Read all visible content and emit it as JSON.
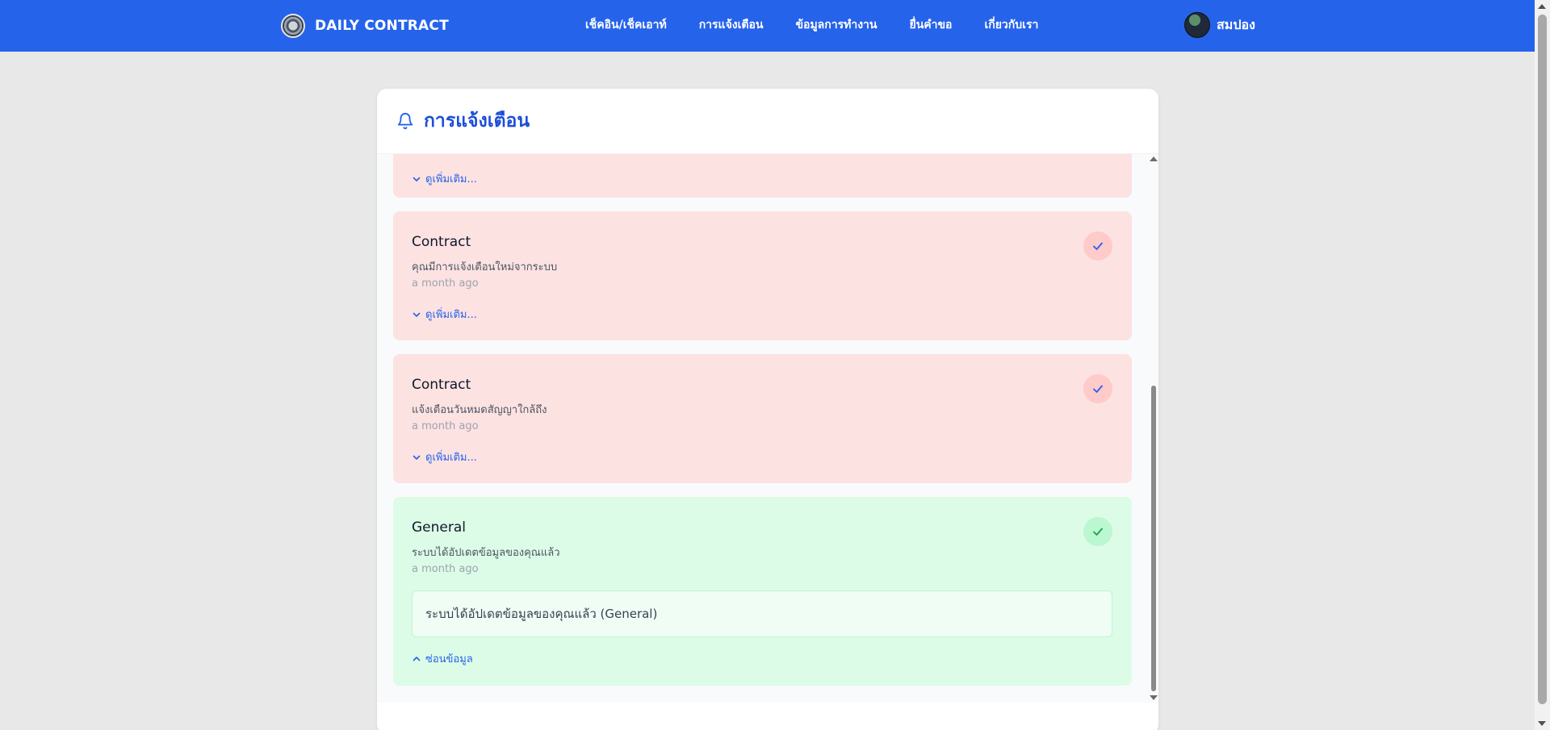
{
  "navbar": {
    "brand": "DAILY CONTRACT",
    "items": [
      {
        "label": "เช็คอิน/เช็คเอาท์"
      },
      {
        "label": "การแจ้งเตือน"
      },
      {
        "label": "ข้อมูลการทำงาน"
      },
      {
        "label": "ยื่นคำขอ"
      },
      {
        "label": "เกี่ยวกับเรา"
      }
    ],
    "user_name": "สมปอง",
    "color": "#2563eb"
  },
  "panel": {
    "title": "การแจ้งเตือน",
    "title_icon": "bell-icon"
  },
  "notifications": [
    {
      "toggle_label": "ดูเพิ่มเติม...",
      "status": "red"
    },
    {
      "title": "Contract",
      "message": "คุณมีการแจ้งเตือนใหม่จากระบบ",
      "time": "a month ago",
      "toggle_label": "ดูเพิ่มเติม...",
      "status": "red"
    },
    {
      "title": "Contract",
      "message": "แจ้งเตือนวันหมดสัญญาใกล้ถึง",
      "time": "a month ago",
      "toggle_label": "ดูเพิ่มเติม...",
      "status": "red"
    },
    {
      "title": "General",
      "message": "ระบบได้อัปเดตข้อมูลของคุณแล้ว",
      "time": "a month ago",
      "detail": "ระบบได้อัปเดตข้อมูลของคุณแล้ว (General)",
      "toggle_label": "ซ่อนข้อมูล",
      "status": "green"
    }
  ],
  "colors": {
    "unread_bg": "#fde2e2",
    "read_bg": "#dcfce7",
    "accent": "#2563eb"
  }
}
